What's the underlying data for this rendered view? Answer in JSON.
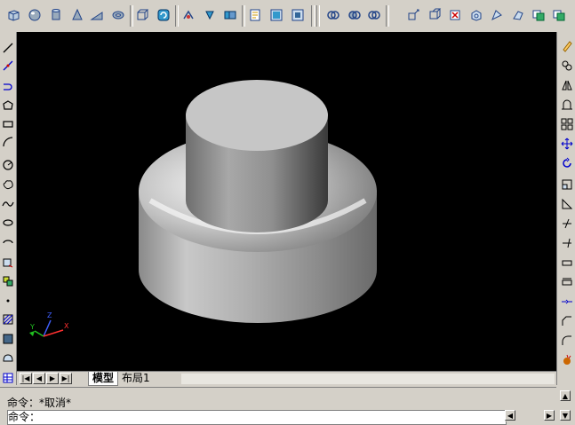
{
  "toolbar": {
    "top_icons": [
      "box-icon",
      "sphere-icon",
      "cylinder-icon",
      "cone-icon",
      "wedge-icon",
      "torus-icon",
      "extrude-icon",
      "revolve-icon",
      "section-icon",
      "slice-icon",
      "interfere-icon",
      "view-icon",
      "layout-icon",
      "solid-edit-icon",
      "union-icon",
      "subtract-icon",
      "intersect-icon",
      "extrude-faces-icon",
      "move-faces-icon",
      "offset-faces-icon",
      "delete-faces-icon",
      "rotate-faces-icon",
      "taper-faces-icon",
      "copy-faces-icon",
      "color-faces-icon",
      "copy-edges-icon",
      "color-edges-icon"
    ]
  },
  "left_toolbar": {
    "icons": [
      "line-icon",
      "construction-line-icon",
      "polyline-icon",
      "polygon-icon",
      "rectangle-icon",
      "arc-icon",
      "circle-icon",
      "revcloud-icon",
      "spline-icon",
      "ellipse-icon",
      "ellipse-arc-icon",
      "insert-block-icon",
      "make-block-icon",
      "point-icon",
      "hatch-icon",
      "gradient-icon",
      "region-icon",
      "table-icon"
    ]
  },
  "right_toolbar": {
    "icons": [
      "erase-icon",
      "copy-icon",
      "mirror-icon",
      "offset-icon",
      "array-icon",
      "move-icon",
      "rotate-icon",
      "scale-icon",
      "stretch-icon",
      "trim-icon",
      "extend-icon",
      "break-at-point-icon",
      "break-icon",
      "join-icon",
      "chamfer-icon",
      "fillet-icon",
      "explode-icon"
    ]
  },
  "viewport": {
    "ucs": {
      "z": "Z",
      "y": "Y",
      "x": "X"
    }
  },
  "tabs": {
    "model": "模型",
    "layout1": "布局1"
  },
  "command": {
    "line1_prompt": "命令：",
    "line1_text": "*取消*",
    "line2_prompt": "命令："
  }
}
